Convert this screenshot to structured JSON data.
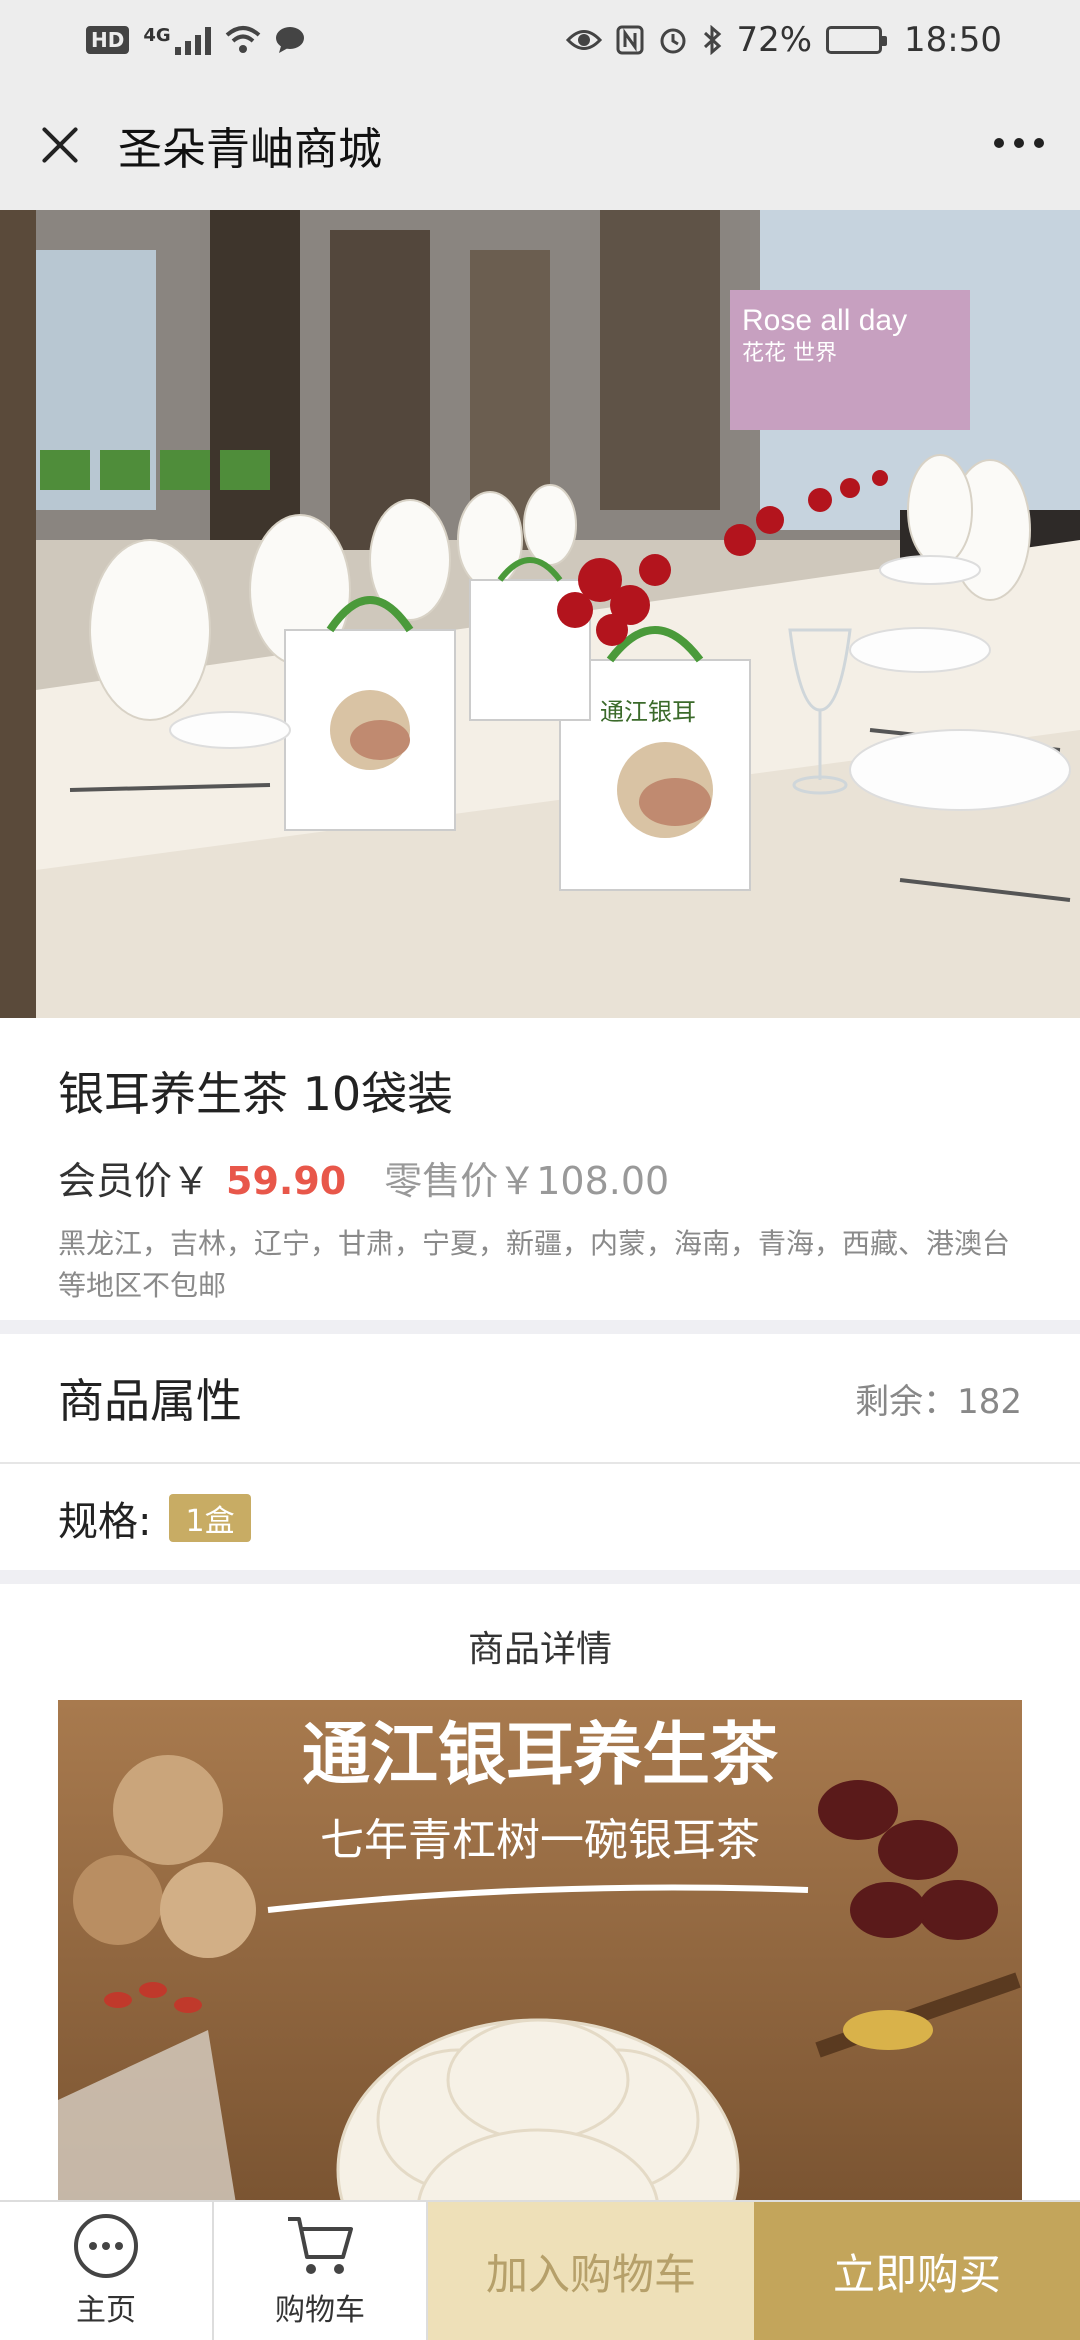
{
  "status": {
    "battery": "72%",
    "time": "18:50",
    "network": "4G",
    "hd_label": "HD",
    "battery_level": 0.72
  },
  "nav": {
    "title": "圣朵青岫商城"
  },
  "product": {
    "title": "银耳养生茶 10袋装",
    "member_price_label": "会员价￥",
    "member_price": "59.90",
    "retail_price": "零售价￥108.00",
    "shipping_note": "黑龙江，吉林，辽宁，甘肃，宁夏，新疆，内蒙，海南，青海，西藏、港澳台等地区不包邮"
  },
  "hero_image": {
    "banner_text_1": "Rose all day",
    "banner_text_2": "花花 世界",
    "bag_text": "通江银耳"
  },
  "attributes": {
    "title": "商品属性",
    "stock": "剩余：182",
    "spec_label": "规格:",
    "spec_value": "1盒"
  },
  "details": {
    "title": "商品详情",
    "banner_title": "通江银耳养生茶",
    "banner_subtitle": "七年青杠树一碗银耳茶"
  },
  "bottom": {
    "home": "主页",
    "cart": "购物车",
    "add_to_cart": "加入购物车",
    "buy_now": "立即购买"
  },
  "colors": {
    "accent_gold": "#c3a55b",
    "price_red": "#e8574a",
    "cart_btn_bg": "#eee0b8"
  }
}
